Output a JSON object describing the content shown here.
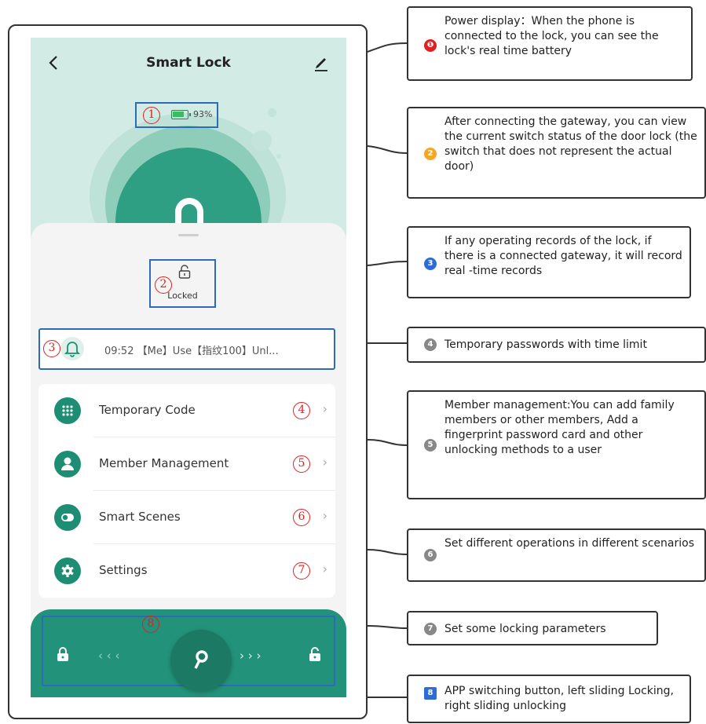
{
  "app": {
    "title": "Smart Lock",
    "battery_percent": "93%",
    "battery_level": 0.93,
    "lock_status": "Locked",
    "latest_record": "09:52 【Me】Use【指纹100】Unl...",
    "menu": [
      {
        "label": "Temporary Code",
        "icon": "grid-dots-icon",
        "marker": "4"
      },
      {
        "label": "Member Management",
        "icon": "person-icon",
        "marker": "5"
      },
      {
        "label": "Smart Scenes",
        "icon": "toggle-icon",
        "marker": "6"
      },
      {
        "label": "Settings",
        "icon": "gear-icon",
        "marker": "7"
      }
    ],
    "markers": {
      "battery": "1",
      "status": "2",
      "record": "3",
      "slider": "8"
    },
    "slider": {
      "left_arrows": "‹ ‹ ‹",
      "right_arrows": "› › ›"
    }
  },
  "annotations": [
    {
      "badge": "❶",
      "badge_color": "#e02020",
      "text": "Power display：When the phone is connected to the lock, you can see the lock's real time battery"
    },
    {
      "badge": "2",
      "badge_color": "#f5a623",
      "text": "After connecting the gateway, you can view the current switch status of the door lock (the switch that does not represent the actual door)"
    },
    {
      "badge": "3",
      "badge_color": "#2d6bd6",
      "text": "If any operating records of the lock, if there is a connected gateway, it will record real -time records"
    },
    {
      "badge": "4",
      "badge_color": "#888888",
      "text": "Temporary passwords with time limit"
    },
    {
      "badge": "5",
      "badge_color": "#888888",
      "text": "Member management:You can add family members or other members, Add a fingerprint password card and other unlocking methods to a user"
    },
    {
      "badge": "6",
      "badge_color": "#888888",
      "text": "Set different operations in different scenarios"
    },
    {
      "badge": "7",
      "badge_color": "#888888",
      "text": "Set some locking parameters"
    },
    {
      "badge": "8",
      "badge_color": "#2d6bd6",
      "text": "APP switching button, left sliding Locking, right sliding unlocking"
    }
  ],
  "colors": {
    "accent": "#1d8d73",
    "highlight_box": "#2d6bb5",
    "marker_red": "#e02020"
  }
}
